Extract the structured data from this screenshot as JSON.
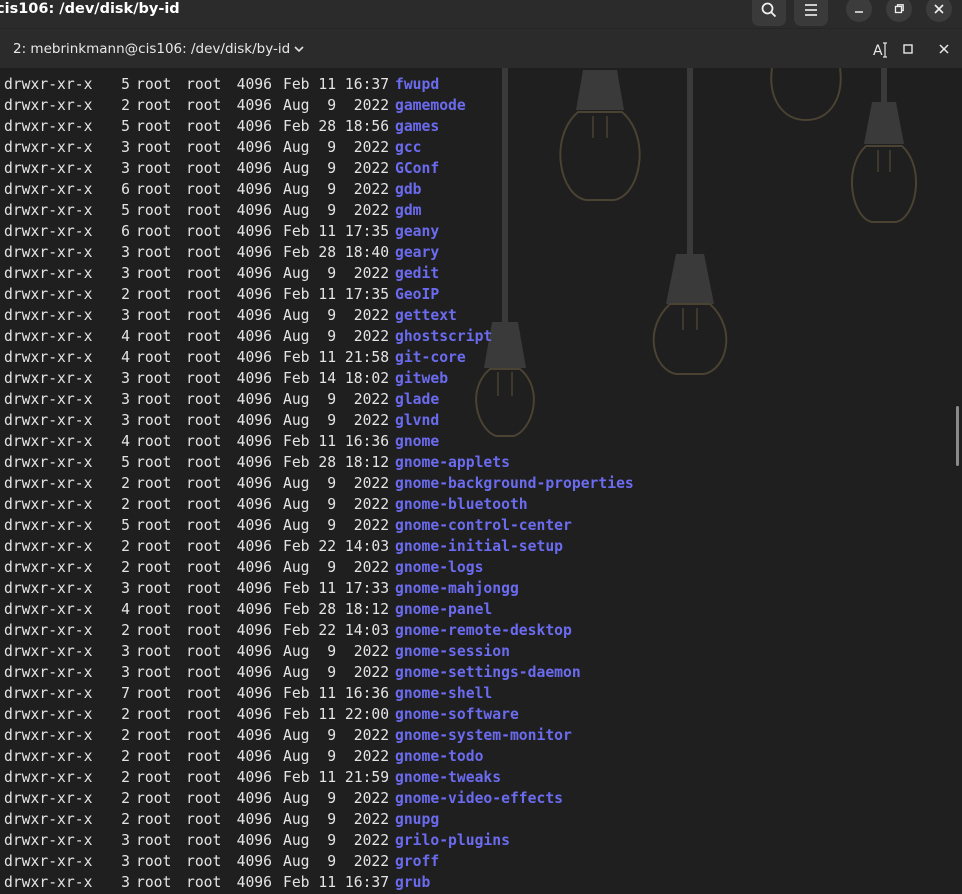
{
  "window": {
    "title": "cis106: /dev/disk/by-id"
  },
  "tab": {
    "title": "2: mebrinkmann@cis106: /dev/disk/by-id"
  },
  "colors": {
    "directory": "#6b6bf0",
    "text": "#e4e4e4",
    "background": "#1f1f1f",
    "chrome": "#2b2b2b"
  },
  "icons": {
    "search": "search-icon",
    "menu": "menu-icon",
    "minimize": "minimize-icon",
    "restore": "restore-icon",
    "close": "close-icon",
    "tab_menu": "chevron-down-icon",
    "font": "text-size-icon",
    "tab_restore": "square-icon",
    "tab_close": "close-icon"
  },
  "listing": [
    {
      "perm": "drwxr-xr-x",
      "links": "5",
      "owner": "root",
      "group": "root",
      "size": "4096",
      "date": "Feb 11 16:37",
      "name": "fwupd"
    },
    {
      "perm": "drwxr-xr-x",
      "links": "2",
      "owner": "root",
      "group": "root",
      "size": "4096",
      "date": "Aug  9  2022",
      "name": "gamemode"
    },
    {
      "perm": "drwxr-xr-x",
      "links": "5",
      "owner": "root",
      "group": "root",
      "size": "4096",
      "date": "Feb 28 18:56",
      "name": "games"
    },
    {
      "perm": "drwxr-xr-x",
      "links": "3",
      "owner": "root",
      "group": "root",
      "size": "4096",
      "date": "Aug  9  2022",
      "name": "gcc"
    },
    {
      "perm": "drwxr-xr-x",
      "links": "3",
      "owner": "root",
      "group": "root",
      "size": "4096",
      "date": "Aug  9  2022",
      "name": "GConf"
    },
    {
      "perm": "drwxr-xr-x",
      "links": "6",
      "owner": "root",
      "group": "root",
      "size": "4096",
      "date": "Aug  9  2022",
      "name": "gdb"
    },
    {
      "perm": "drwxr-xr-x",
      "links": "5",
      "owner": "root",
      "group": "root",
      "size": "4096",
      "date": "Aug  9  2022",
      "name": "gdm"
    },
    {
      "perm": "drwxr-xr-x",
      "links": "6",
      "owner": "root",
      "group": "root",
      "size": "4096",
      "date": "Feb 11 17:35",
      "name": "geany"
    },
    {
      "perm": "drwxr-xr-x",
      "links": "3",
      "owner": "root",
      "group": "root",
      "size": "4096",
      "date": "Feb 28 18:40",
      "name": "geary"
    },
    {
      "perm": "drwxr-xr-x",
      "links": "3",
      "owner": "root",
      "group": "root",
      "size": "4096",
      "date": "Aug  9  2022",
      "name": "gedit"
    },
    {
      "perm": "drwxr-xr-x",
      "links": "2",
      "owner": "root",
      "group": "root",
      "size": "4096",
      "date": "Feb 11 17:35",
      "name": "GeoIP"
    },
    {
      "perm": "drwxr-xr-x",
      "links": "3",
      "owner": "root",
      "group": "root",
      "size": "4096",
      "date": "Aug  9  2022",
      "name": "gettext"
    },
    {
      "perm": "drwxr-xr-x",
      "links": "4",
      "owner": "root",
      "group": "root",
      "size": "4096",
      "date": "Aug  9  2022",
      "name": "ghostscript"
    },
    {
      "perm": "drwxr-xr-x",
      "links": "4",
      "owner": "root",
      "group": "root",
      "size": "4096",
      "date": "Feb 11 21:58",
      "name": "git-core"
    },
    {
      "perm": "drwxr-xr-x",
      "links": "3",
      "owner": "root",
      "group": "root",
      "size": "4096",
      "date": "Feb 14 18:02",
      "name": "gitweb"
    },
    {
      "perm": "drwxr-xr-x",
      "links": "3",
      "owner": "root",
      "group": "root",
      "size": "4096",
      "date": "Aug  9  2022",
      "name": "glade"
    },
    {
      "perm": "drwxr-xr-x",
      "links": "3",
      "owner": "root",
      "group": "root",
      "size": "4096",
      "date": "Aug  9  2022",
      "name": "glvnd"
    },
    {
      "perm": "drwxr-xr-x",
      "links": "4",
      "owner": "root",
      "group": "root",
      "size": "4096",
      "date": "Feb 11 16:36",
      "name": "gnome"
    },
    {
      "perm": "drwxr-xr-x",
      "links": "5",
      "owner": "root",
      "group": "root",
      "size": "4096",
      "date": "Feb 28 18:12",
      "name": "gnome-applets"
    },
    {
      "perm": "drwxr-xr-x",
      "links": "2",
      "owner": "root",
      "group": "root",
      "size": "4096",
      "date": "Aug  9  2022",
      "name": "gnome-background-properties"
    },
    {
      "perm": "drwxr-xr-x",
      "links": "2",
      "owner": "root",
      "group": "root",
      "size": "4096",
      "date": "Aug  9  2022",
      "name": "gnome-bluetooth"
    },
    {
      "perm": "drwxr-xr-x",
      "links": "5",
      "owner": "root",
      "group": "root",
      "size": "4096",
      "date": "Aug  9  2022",
      "name": "gnome-control-center"
    },
    {
      "perm": "drwxr-xr-x",
      "links": "2",
      "owner": "root",
      "group": "root",
      "size": "4096",
      "date": "Feb 22 14:03",
      "name": "gnome-initial-setup"
    },
    {
      "perm": "drwxr-xr-x",
      "links": "2",
      "owner": "root",
      "group": "root",
      "size": "4096",
      "date": "Aug  9  2022",
      "name": "gnome-logs"
    },
    {
      "perm": "drwxr-xr-x",
      "links": "3",
      "owner": "root",
      "group": "root",
      "size": "4096",
      "date": "Feb 11 17:33",
      "name": "gnome-mahjongg"
    },
    {
      "perm": "drwxr-xr-x",
      "links": "4",
      "owner": "root",
      "group": "root",
      "size": "4096",
      "date": "Feb 28 18:12",
      "name": "gnome-panel"
    },
    {
      "perm": "drwxr-xr-x",
      "links": "2",
      "owner": "root",
      "group": "root",
      "size": "4096",
      "date": "Feb 22 14:03",
      "name": "gnome-remote-desktop"
    },
    {
      "perm": "drwxr-xr-x",
      "links": "3",
      "owner": "root",
      "group": "root",
      "size": "4096",
      "date": "Aug  9  2022",
      "name": "gnome-session"
    },
    {
      "perm": "drwxr-xr-x",
      "links": "3",
      "owner": "root",
      "group": "root",
      "size": "4096",
      "date": "Aug  9  2022",
      "name": "gnome-settings-daemon"
    },
    {
      "perm": "drwxr-xr-x",
      "links": "7",
      "owner": "root",
      "group": "root",
      "size": "4096",
      "date": "Feb 11 16:36",
      "name": "gnome-shell"
    },
    {
      "perm": "drwxr-xr-x",
      "links": "2",
      "owner": "root",
      "group": "root",
      "size": "4096",
      "date": "Feb 11 22:00",
      "name": "gnome-software"
    },
    {
      "perm": "drwxr-xr-x",
      "links": "2",
      "owner": "root",
      "group": "root",
      "size": "4096",
      "date": "Aug  9  2022",
      "name": "gnome-system-monitor"
    },
    {
      "perm": "drwxr-xr-x",
      "links": "2",
      "owner": "root",
      "group": "root",
      "size": "4096",
      "date": "Aug  9  2022",
      "name": "gnome-todo"
    },
    {
      "perm": "drwxr-xr-x",
      "links": "2",
      "owner": "root",
      "group": "root",
      "size": "4096",
      "date": "Feb 11 21:59",
      "name": "gnome-tweaks"
    },
    {
      "perm": "drwxr-xr-x",
      "links": "2",
      "owner": "root",
      "group": "root",
      "size": "4096",
      "date": "Aug  9  2022",
      "name": "gnome-video-effects"
    },
    {
      "perm": "drwxr-xr-x",
      "links": "2",
      "owner": "root",
      "group": "root",
      "size": "4096",
      "date": "Aug  9  2022",
      "name": "gnupg"
    },
    {
      "perm": "drwxr-xr-x",
      "links": "3",
      "owner": "root",
      "group": "root",
      "size": "4096",
      "date": "Aug  9  2022",
      "name": "grilo-plugins"
    },
    {
      "perm": "drwxr-xr-x",
      "links": "3",
      "owner": "root",
      "group": "root",
      "size": "4096",
      "date": "Aug  9  2022",
      "name": "groff"
    },
    {
      "perm": "drwxr-xr-x",
      "links": "3",
      "owner": "root",
      "group": "root",
      "size": "4096",
      "date": "Feb 11 16:37",
      "name": "grub"
    }
  ]
}
